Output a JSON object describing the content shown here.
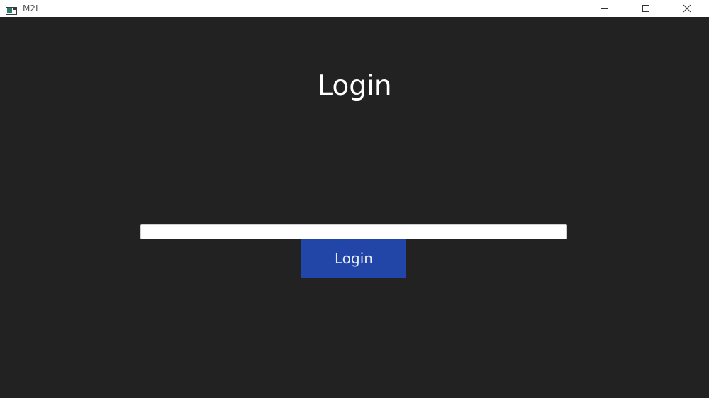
{
  "window": {
    "title": "M2L",
    "app_icon": "window-app-icon",
    "controls": {
      "minimize_icon": "minimize-icon",
      "maximize_icon": "maximize-icon",
      "close_icon": "close-icon"
    }
  },
  "login_form": {
    "heading": "Login",
    "input_value": "",
    "input_placeholder": "",
    "submit_label": "Login"
  },
  "colors": {
    "background": "#222222",
    "titlebar": "#ffffff",
    "accent_button": "#2146a8",
    "heading_text": "#ffffff"
  }
}
